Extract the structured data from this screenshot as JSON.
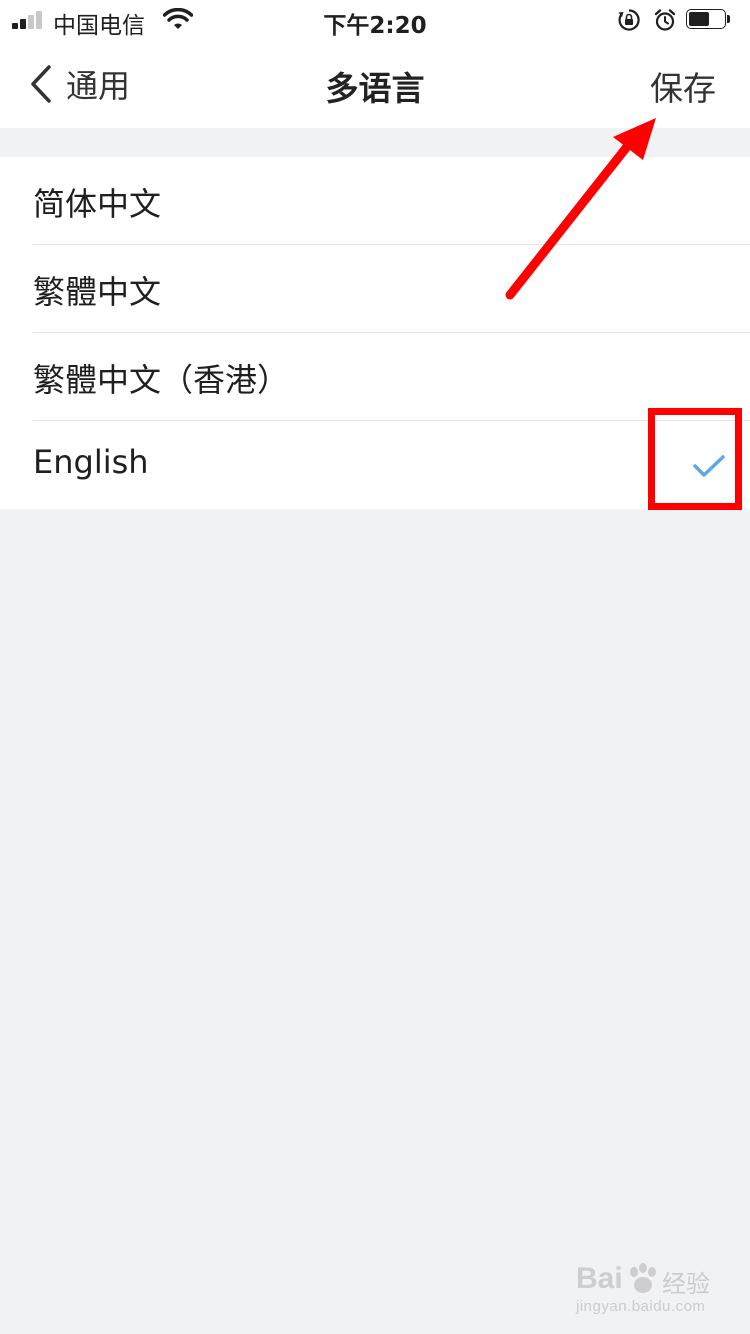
{
  "status_bar": {
    "carrier": "中国电信",
    "time": "下午2:20",
    "battery_level": 0.6
  },
  "nav": {
    "back_label": "通用",
    "title": "多语言",
    "save_label": "保存"
  },
  "languages": [
    {
      "label": "简体中文",
      "selected": false
    },
    {
      "label": "繁體中文",
      "selected": false
    },
    {
      "label": "繁體中文（香港）",
      "selected": false
    },
    {
      "label": "English",
      "selected": true
    }
  ],
  "colors": {
    "check": "#5aa9e6",
    "annotation": "#ff0000",
    "background": "#f1f2f4"
  },
  "watermark": {
    "brand": "Bai",
    "cn": "经验",
    "url": "jingyan.baidu.com"
  }
}
